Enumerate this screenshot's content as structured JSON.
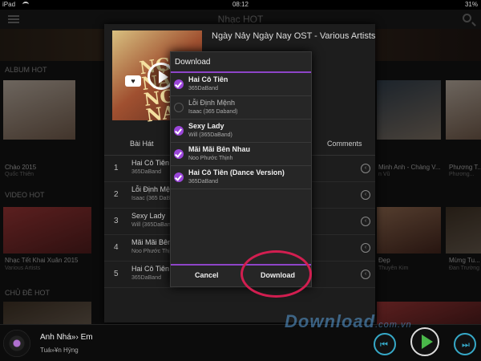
{
  "status_bar": {
    "device": "iPad",
    "time": "08:12",
    "battery": "31%"
  },
  "header": {
    "title": "Nhạc HOT"
  },
  "sections": {
    "album_hot": "ALBUM HOT",
    "video_hot": "VIDEO HOT",
    "topic_hot": "CHỦ ĐỀ HOT"
  },
  "background": {
    "album_left": {
      "title": "Chào 2015",
      "artist": "Quốc Thiên"
    },
    "album_right1": {
      "title": "Minh Anh - Chàng V...",
      "artist": "n Vũ"
    },
    "album_right2": {
      "title": "Phương T...",
      "artist": "Phương..."
    },
    "video_left": {
      "title": "Nhạc Tết Khai Xuân 2015",
      "artist": "Various Artists"
    },
    "video_right1": {
      "title": "Đẹp",
      "artist": "Thuyên Kim"
    },
    "video_right2": {
      "title": "Mừng Tu...",
      "artist": "Đan Trường"
    }
  },
  "album": {
    "title": "Ngày Nảy Ngày Nay OST - Various Artists",
    "art_text": "NGÀY NẢY NGÀY NAY",
    "heart": "♥",
    "tabs": [
      "Bài Hát",
      "Comments"
    ],
    "songs": [
      {
        "num": "1",
        "name": "Hai Cô Tiên",
        "artist": "365DaBand"
      },
      {
        "num": "2",
        "name": "Lỗi Định Mện",
        "artist": "Isaac (365 DaBand"
      },
      {
        "num": "3",
        "name": "Sexy Lady",
        "artist": "Will (365DaBand)"
      },
      {
        "num": "4",
        "name": "Mãi Mãi Bên",
        "artist": "Noo Phước Thịnh"
      },
      {
        "num": "5",
        "name": "Hai Cô Tiên (",
        "artist": "365DaBand"
      }
    ]
  },
  "dialog": {
    "title": "Download",
    "items": [
      {
        "name": "Hai Cô Tiên",
        "artist": "365DaBand",
        "checked": true
      },
      {
        "name": "Lỗi Định Mệnh",
        "artist": "Isaac (365 Daband)",
        "checked": false
      },
      {
        "name": "Sexy Lady",
        "artist": "Will (365DaBand)",
        "checked": true
      },
      {
        "name": "Mãi Mãi Bên Nhau",
        "artist": "Noo Phước Thịnh",
        "checked": true
      },
      {
        "name": "Hai Cô Tiên (Dance Version)",
        "artist": "365DaBand",
        "checked": true
      }
    ],
    "cancel_label": "Cancel",
    "download_label": "Download"
  },
  "player": {
    "song": "Anh Nhá»› Em",
    "artist": "Tuá»¥n Hÿng",
    "prev_icon": "⏮",
    "next_icon": "⏭"
  },
  "watermark": {
    "brand": "Download",
    "suffix": ".com.vn"
  },
  "colors": {
    "accent": "#9b46d9",
    "highlight": "#d21e50",
    "player_blue": "#36a9c8",
    "play_green": "#4ab84a"
  }
}
